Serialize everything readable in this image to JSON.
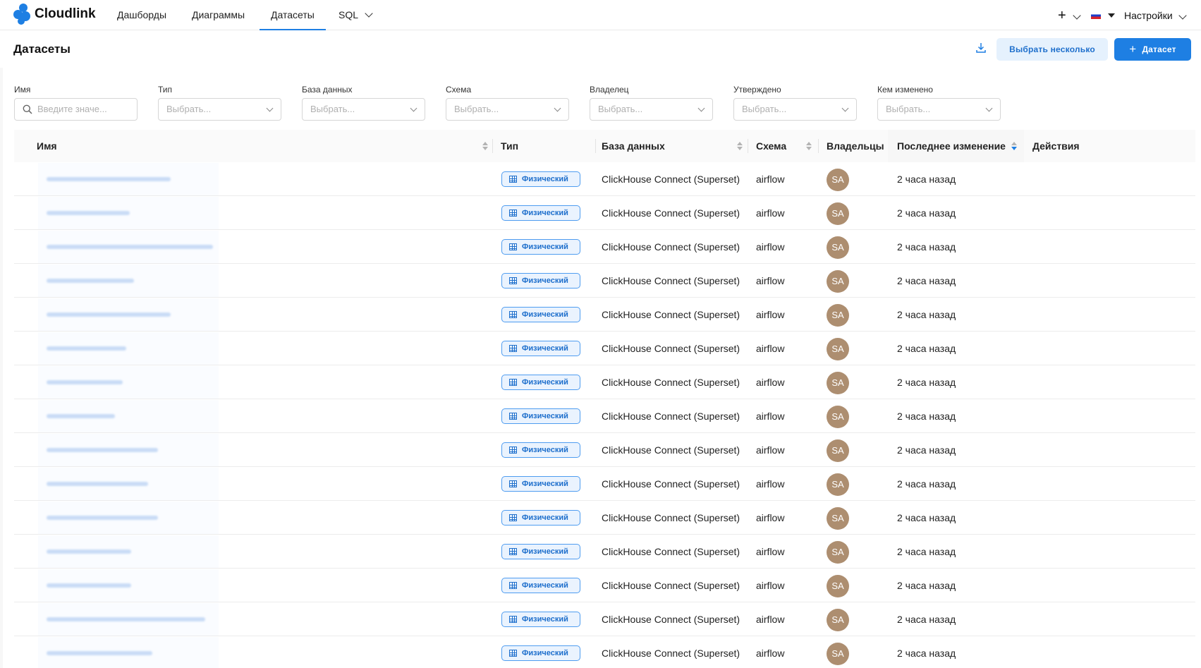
{
  "brand": {
    "name": "Cloudlink",
    "accent": "#1e7fe3"
  },
  "nav": {
    "items": [
      {
        "label": "Дашборды"
      },
      {
        "label": "Диаграммы"
      },
      {
        "label": "Датасеты",
        "active": true
      },
      {
        "label": "SQL",
        "dropdown": true
      }
    ],
    "right": {
      "plus_icon": "plus-icon",
      "language_flag": "ru-flag-icon",
      "settings_label": "Настройки"
    }
  },
  "header": {
    "title": "Датасеты",
    "download_icon": "download-icon",
    "bulk_select_label": "Выбрать несколько",
    "add_dataset_label": "Датасет"
  },
  "filters": [
    {
      "label": "Имя",
      "placeholder": "Введите значе...",
      "type": "search"
    },
    {
      "label": "Тип",
      "placeholder": "Выбрать..."
    },
    {
      "label": "База данных",
      "placeholder": "Выбрать..."
    },
    {
      "label": "Схема",
      "placeholder": "Выбрать..."
    },
    {
      "label": "Владелец",
      "placeholder": "Выбрать..."
    },
    {
      "label": "Утверждено",
      "placeholder": "Выбрать..."
    },
    {
      "label": "Кем изменено",
      "placeholder": "Выбрать..."
    }
  ],
  "table": {
    "columns": [
      "Имя",
      "Тип",
      "База данных",
      "Схема",
      "Владельцы",
      "Последнее изменение",
      "Действия"
    ],
    "sorted_column": "Последнее изменение",
    "rows": [
      {
        "type": "Физический",
        "database": "ClickHouse Connect (Superset)",
        "schema": "airflow",
        "owner": "SA",
        "modified": "2 часа назад"
      },
      {
        "type": "Физический",
        "database": "ClickHouse Connect (Superset)",
        "schema": "airflow",
        "owner": "SA",
        "modified": "2 часа назад"
      },
      {
        "type": "Физический",
        "database": "ClickHouse Connect (Superset)",
        "schema": "airflow",
        "owner": "SA",
        "modified": "2 часа назад"
      },
      {
        "type": "Физический",
        "database": "ClickHouse Connect (Superset)",
        "schema": "airflow",
        "owner": "SA",
        "modified": "2 часа назад"
      },
      {
        "type": "Физический",
        "database": "ClickHouse Connect (Superset)",
        "schema": "airflow",
        "owner": "SA",
        "modified": "2 часа назад"
      },
      {
        "type": "Физический",
        "database": "ClickHouse Connect (Superset)",
        "schema": "airflow",
        "owner": "SA",
        "modified": "2 часа назад"
      },
      {
        "type": "Физический",
        "database": "ClickHouse Connect (Superset)",
        "schema": "airflow",
        "owner": "SA",
        "modified": "2 часа назад"
      },
      {
        "type": "Физический",
        "database": "ClickHouse Connect (Superset)",
        "schema": "airflow",
        "owner": "SA",
        "modified": "2 часа назад"
      },
      {
        "type": "Физический",
        "database": "ClickHouse Connect (Superset)",
        "schema": "airflow",
        "owner": "SA",
        "modified": "2 часа назад"
      },
      {
        "type": "Физический",
        "database": "ClickHouse Connect (Superset)",
        "schema": "airflow",
        "owner": "SA",
        "modified": "2 часа назад"
      },
      {
        "type": "Физический",
        "database": "ClickHouse Connect (Superset)",
        "schema": "airflow",
        "owner": "SA",
        "modified": "2 часа назад"
      },
      {
        "type": "Физический",
        "database": "ClickHouse Connect (Superset)",
        "schema": "airflow",
        "owner": "SA",
        "modified": "2 часа назад"
      },
      {
        "type": "Физический",
        "database": "ClickHouse Connect (Superset)",
        "schema": "airflow",
        "owner": "SA",
        "modified": "2 часа назад"
      },
      {
        "type": "Физический",
        "database": "ClickHouse Connect (Superset)",
        "schema": "airflow",
        "owner": "SA",
        "modified": "2 часа назад"
      },
      {
        "type": "Физический",
        "database": "ClickHouse Connect (Superset)",
        "schema": "airflow",
        "owner": "SA",
        "modified": "2 часа назад"
      }
    ]
  }
}
